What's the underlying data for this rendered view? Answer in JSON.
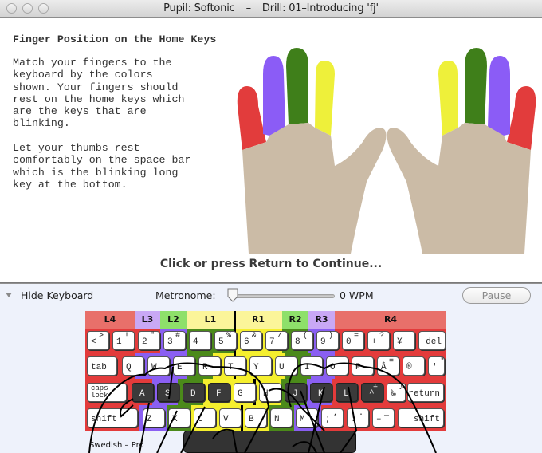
{
  "window": {
    "title_left": "Pupil: Softonic",
    "title_sep": "–",
    "title_right": "Drill: 01–Introducing 'fj'"
  },
  "lesson": {
    "heading": "Finger Position on the Home Keys",
    "paragraph1": "Match your fingers to the\nkeyboard by the colors\nshown. Your fingers should\nrest on the home keys which\nare the keys that are\nblinking.",
    "paragraph2": "Let your thumbs rest\ncomfortably on the space bar\nwhich is the blinking long\nkey at the bottom.",
    "continue_prompt": "Click or press Return to Continue...",
    "finger_colors": {
      "pinky": "#e23c3c",
      "ring": "#8b5cf6",
      "middle": "#3f7f1a",
      "index": "#eef03a",
      "palm": "#cbbba6"
    }
  },
  "controls": {
    "hide_keyboard_label": "Hide Keyboard",
    "metronome_label": "Metronome:",
    "metronome_value_wpm": 0,
    "wpm_text": "0 WPM",
    "pause_label": "Pause"
  },
  "keyboard": {
    "layout_name": "Swedish – Pro",
    "zones": [
      {
        "label": "L4",
        "color": "#e8706a"
      },
      {
        "label": "L3",
        "color": "#c9a8f5"
      },
      {
        "label": "L2",
        "color": "#8ee06a"
      },
      {
        "label": "L1",
        "color": "#fbf59a"
      },
      {
        "label": "R1",
        "color": "#fbf59a"
      },
      {
        "label": "R2",
        "color": "#8ee06a"
      },
      {
        "label": "R3",
        "color": "#c9a8f5"
      },
      {
        "label": "R4",
        "color": "#e8706a"
      }
    ],
    "rows": [
      [
        {
          "main": "<",
          "shift": ">"
        },
        {
          "main": "1",
          "shift": "!"
        },
        {
          "main": "2",
          "shift": "\""
        },
        {
          "main": "3",
          "shift": "#"
        },
        {
          "main": "4",
          "shift": ""
        },
        {
          "main": "5",
          "shift": "%"
        },
        {
          "main": "6",
          "shift": "&"
        },
        {
          "main": "7",
          "shift": "/"
        },
        {
          "main": "8",
          "shift": "("
        },
        {
          "main": "9",
          "shift": ")"
        },
        {
          "main": "0",
          "shift": "="
        },
        {
          "main": "+",
          "shift": "?"
        },
        {
          "main": "¥",
          "shift": ""
        },
        {
          "main": "del",
          "shift": ""
        }
      ],
      [
        {
          "main": "tab"
        },
        {
          "main": "Q"
        },
        {
          "main": "W"
        },
        {
          "main": "E"
        },
        {
          "main": "R"
        },
        {
          "main": "T"
        },
        {
          "main": "Y"
        },
        {
          "main": "U"
        },
        {
          "main": "I"
        },
        {
          "main": "O"
        },
        {
          "main": "P"
        },
        {
          "main": "Â",
          "shift": "="
        },
        {
          "main": "®",
          "shift": ""
        },
        {
          "main": "'",
          "shift": "*"
        }
      ],
      [
        {
          "main": "caps lock"
        },
        {
          "main": "A"
        },
        {
          "main": "S"
        },
        {
          "main": "D"
        },
        {
          "main": "F"
        },
        {
          "main": "G"
        },
        {
          "main": "H"
        },
        {
          "main": "J"
        },
        {
          "main": "K"
        },
        {
          "main": "L"
        },
        {
          "main": "^",
          "shift": "÷"
        },
        {
          "main": "‰",
          "shift": "♪"
        },
        {
          "main": "return"
        }
      ],
      [
        {
          "main": "shift"
        },
        {
          "main": "Z"
        },
        {
          "main": "X"
        },
        {
          "main": "C"
        },
        {
          "main": "V"
        },
        {
          "main": "B"
        },
        {
          "main": "N"
        },
        {
          "main": "M"
        },
        {
          "main": ";",
          "shift": ","
        },
        {
          "main": ":",
          "shift": "."
        },
        {
          "main": "–",
          "shift": "_"
        },
        {
          "main": "shift"
        }
      ]
    ],
    "home_keys": [
      "A",
      "S",
      "D",
      "F",
      "J",
      "K",
      "L",
      "^"
    ]
  }
}
